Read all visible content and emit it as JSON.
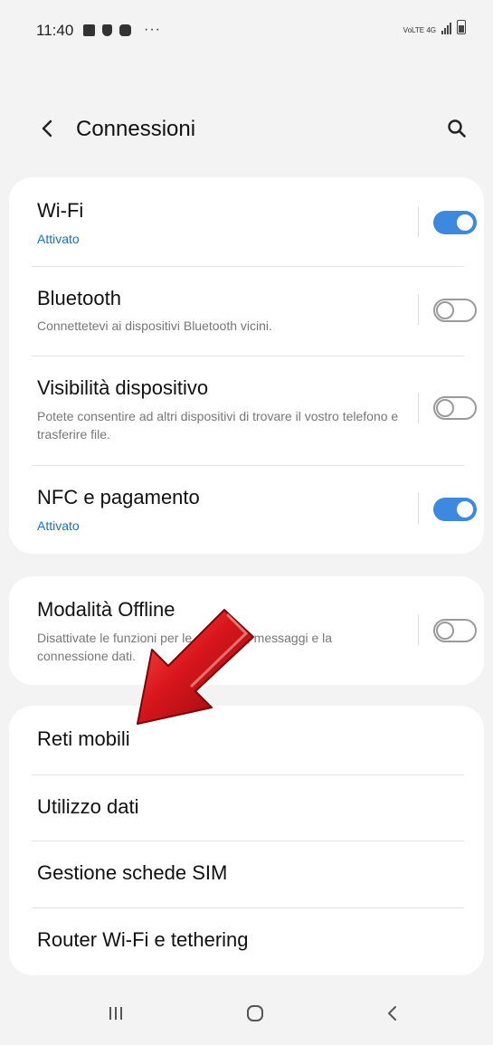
{
  "status_bar": {
    "time": "11:40",
    "dots": "···",
    "network_label": "VoLTE 4G"
  },
  "header": {
    "title": "Connessioni"
  },
  "toggles": [
    {
      "title": "Wi-Fi",
      "subtitle": "Attivato",
      "state": "on"
    },
    {
      "title": "Bluetooth",
      "subtitle": "Connettetevi ai dispositivi Bluetooth vicini.",
      "state": "off"
    },
    {
      "title": "Visibilità dispositivo",
      "subtitle": "Potete consentire ad altri dispositivi di trovare il vostro telefono e trasferire file.",
      "state": "off"
    },
    {
      "title": "NFC e pagamento",
      "subtitle": "Attivato",
      "state": "on"
    }
  ],
  "offline": {
    "title": "Modalità Offline",
    "subtitle": "Disattivate le funzioni per le chiamate, messaggi e la connessione dati.",
    "state": "off"
  },
  "menu": [
    {
      "label": "Reti mobili"
    },
    {
      "label": "Utilizzo dati"
    },
    {
      "label": "Gestione schede SIM"
    },
    {
      "label": "Router Wi-Fi e tethering"
    }
  ],
  "colors": {
    "accent": "#3e89e0",
    "link_blue": "#1b6fc4",
    "arrow_red": "#c8141b",
    "background": "#f3f3f3"
  },
  "icons": {
    "back": "chevron-left-icon",
    "search": "search-icon",
    "nav_recents": "recents-icon",
    "nav_home": "home-icon",
    "nav_back": "back-icon"
  }
}
